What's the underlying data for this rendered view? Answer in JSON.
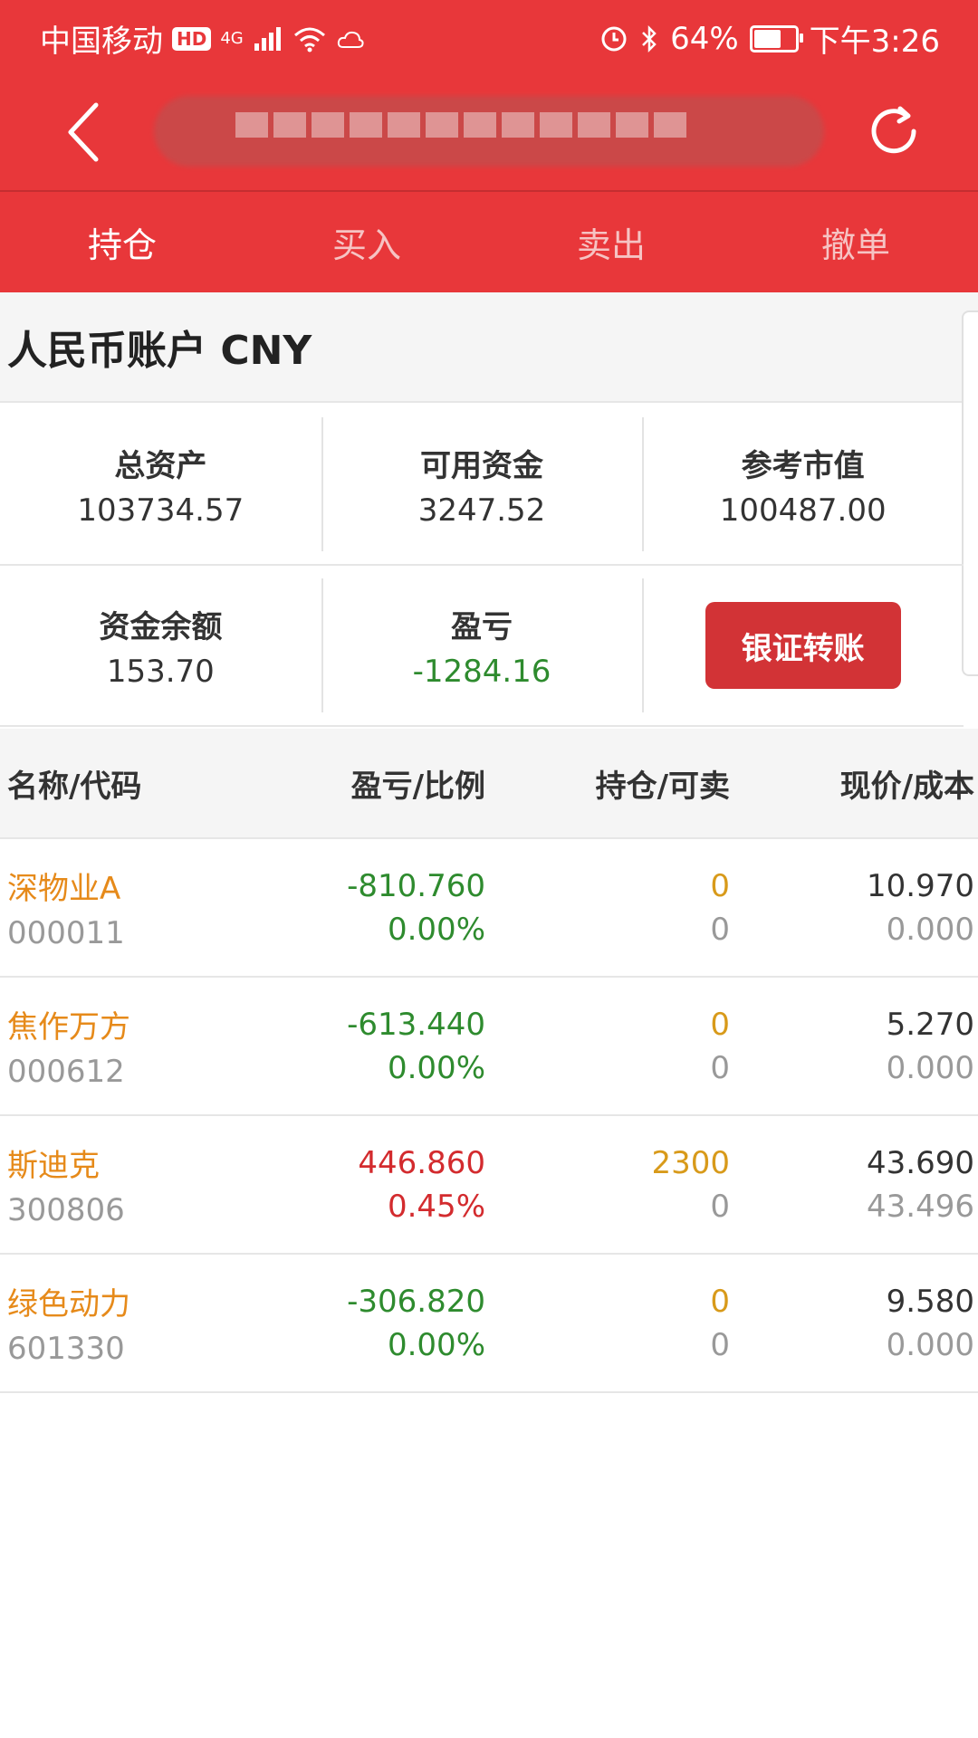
{
  "status_bar": {
    "carrier": "中国移动",
    "hd": "HD",
    "network": "4G",
    "battery": "64%",
    "time": "下午3:26"
  },
  "tabs": [
    {
      "label": "持仓",
      "active": true
    },
    {
      "label": "买入",
      "active": false
    },
    {
      "label": "卖出",
      "active": false
    },
    {
      "label": "撤单",
      "active": false
    }
  ],
  "account": {
    "title": "人民币账户 CNY",
    "total_assets_label": "总资产",
    "total_assets": "103734.57",
    "available_funds_label": "可用资金",
    "available_funds": "3247.52",
    "market_value_label": "参考市值",
    "market_value": "100487.00",
    "balance_label": "资金余额",
    "balance": "153.70",
    "pl_label": "盈亏",
    "pl": "-1284.16",
    "transfer_button": "银证转账"
  },
  "table": {
    "headers": [
      "名称/代码",
      "盈亏/比例",
      "持仓/可卖",
      "现价/成本"
    ],
    "rows": [
      {
        "name": "深物业A",
        "code": "000011",
        "pl": "-810.760",
        "pl_ratio": "0.00%",
        "position": "0",
        "sellable": "0",
        "price": "10.970",
        "cost": "0.000"
      },
      {
        "name": "焦作万方",
        "code": "000612",
        "pl": "-613.440",
        "pl_ratio": "0.00%",
        "position": "0",
        "sellable": "0",
        "price": "5.270",
        "cost": "0.000"
      },
      {
        "name": "斯迪克",
        "code": "300806",
        "pl": "446.860",
        "pl_ratio": "0.45%",
        "position": "2300",
        "sellable": "0",
        "price": "43.690",
        "cost": "43.496"
      },
      {
        "name": "绿色动力",
        "code": "601330",
        "pl": "-306.820",
        "pl_ratio": "0.00%",
        "position": "0",
        "sellable": "0",
        "price": "9.580",
        "cost": "0.000"
      }
    ]
  },
  "colors": {
    "header_red": "#e8373a",
    "button_red": "#d23336",
    "loss_green": "#2e8b2e",
    "gain_red": "#d32b2e",
    "stock_orange": "#e68a1a"
  },
  "icons": {
    "back": "chevron-left-icon",
    "refresh": "refresh-icon"
  }
}
